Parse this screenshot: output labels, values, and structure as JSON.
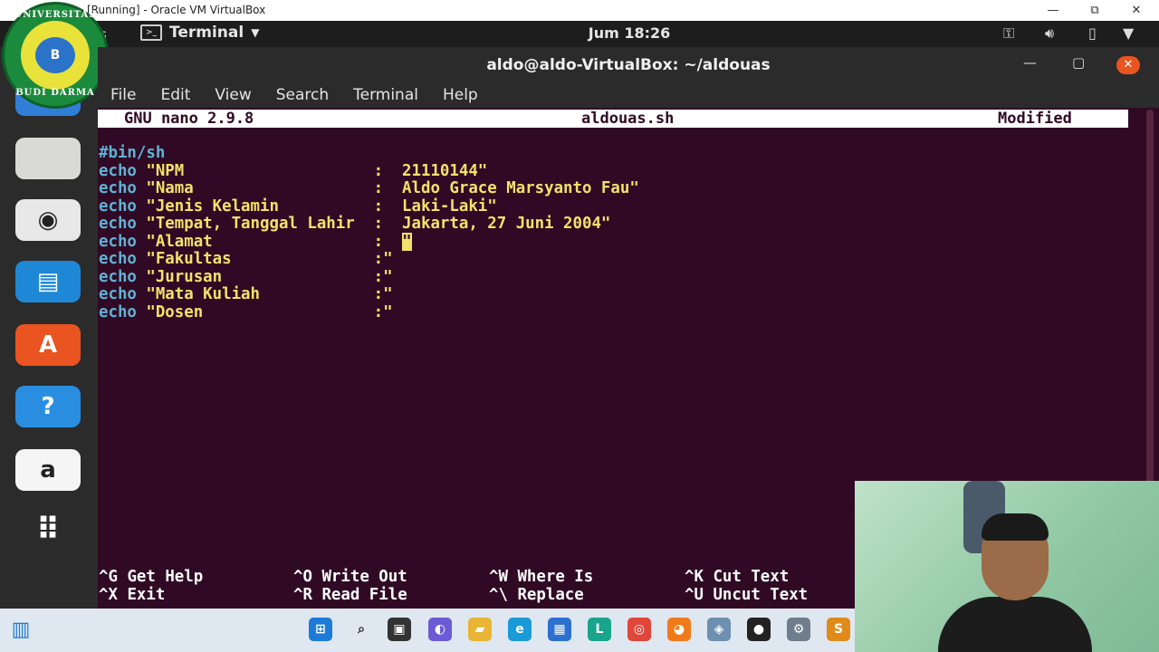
{
  "vbox": {
    "title": "[Running] - Oracle VM VirtualBox",
    "min": "—",
    "max": "⧉",
    "close": "✕"
  },
  "topbar": {
    "activities": "s",
    "app_menu": "Terminal",
    "app_icon_text": ">_",
    "clock": "Jum 18:26"
  },
  "logo": {
    "top_text": "UNIVERSITAS",
    "bottom_text": "BUDI DARMA",
    "center": "B"
  },
  "terminal": {
    "title": "aldo@aldo-VirtualBox: ~/aldouas",
    "menu": [
      "File",
      "Edit",
      "View",
      "Search",
      "Terminal",
      "Help"
    ]
  },
  "nano": {
    "version": "GNU nano 2.9.8",
    "filename": "aldouas.sh",
    "status": "Modified",
    "shebang": "#bin/sh",
    "lines": [
      {
        "kw": "echo",
        "text": " \"NPM                    :  21110144\""
      },
      {
        "kw": "echo",
        "text": " \"Nama                   :  Aldo Grace Marsyanto Fau\""
      },
      {
        "kw": "echo",
        "text": " \"Jenis Kelamin          :  Laki-Laki\""
      },
      {
        "kw": "echo",
        "text": " \"Tempat, Tanggal Lahir  :  Jakarta, 27 Juni 2004\""
      },
      {
        "kw": "echo",
        "text": " \"Alamat                 :  ",
        "cursor": "\""
      },
      {
        "kw": "echo",
        "text": " \"Fakultas               :\""
      },
      {
        "kw": "echo",
        "text": " \"Jurusan                :\""
      },
      {
        "kw": "echo",
        "text": " \"Mata Kuliah            :\""
      },
      {
        "kw": "echo",
        "text": " \"Dosen                  :\""
      }
    ],
    "shortcuts": [
      {
        "key": "^G",
        "label": "Get Help"
      },
      {
        "key": "^O",
        "label": "Write Out"
      },
      {
        "key": "^W",
        "label": "Where Is"
      },
      {
        "key": "^K",
        "label": "Cut Text"
      },
      {
        "key": "^X",
        "label": "Exit"
      },
      {
        "key": "^R",
        "label": "Read File"
      },
      {
        "key": "^\\",
        "label": "Replace"
      },
      {
        "key": "^U",
        "label": "Uncut Text"
      }
    ]
  },
  "dock": [
    {
      "name": "thunderbird-icon",
      "glyph": "✉",
      "color": "#2f7fd8"
    },
    {
      "name": "files-icon",
      "glyph": "",
      "color": "#d9d9d6"
    },
    {
      "name": "rhythmbox-icon",
      "glyph": "◉",
      "color": "#e8e8e8"
    },
    {
      "name": "writer-icon",
      "glyph": "▤",
      "color": "#1e88d6"
    },
    {
      "name": "software-icon",
      "glyph": "A",
      "color": "#e95420"
    },
    {
      "name": "help-icon",
      "glyph": "?",
      "color": "#2a8ee0"
    },
    {
      "name": "amazon-icon",
      "glyph": "a",
      "color": "#f5f5f5"
    },
    {
      "name": "app-grid-icon",
      "glyph": "⠿",
      "color": "transparent"
    }
  ],
  "taskbar": [
    {
      "name": "windows-start-icon",
      "glyph": "⊞",
      "color": "#1c7bd8"
    },
    {
      "name": "search-icon",
      "glyph": "⌕",
      "color": "transparent"
    },
    {
      "name": "task-view-icon",
      "glyph": "▣",
      "color": "#333333"
    },
    {
      "name": "chat-icon",
      "glyph": "◐",
      "color": "#6b5bd6"
    },
    {
      "name": "file-explorer-icon",
      "glyph": "▰",
      "color": "#e8b535"
    },
    {
      "name": "edge-icon",
      "glyph": "e",
      "color": "#1a9ad6"
    },
    {
      "name": "store-icon",
      "glyph": "▦",
      "color": "#2b6fd0"
    },
    {
      "name": "l-app-icon",
      "glyph": "L",
      "color": "#18a58c"
    },
    {
      "name": "chrome-icon",
      "glyph": "◎",
      "color": "#e0463a"
    },
    {
      "name": "firefox-icon",
      "glyph": "◕",
      "color": "#f07a1a"
    },
    {
      "name": "virtualbox-icon",
      "glyph": "◈",
      "color": "#6d8fb0"
    },
    {
      "name": "obs-icon",
      "glyph": "●",
      "color": "#222222"
    },
    {
      "name": "settings-icon",
      "glyph": "⚙",
      "color": "#6f7d8c"
    },
    {
      "name": "sublime-icon",
      "glyph": "S",
      "color": "#e08a1a"
    }
  ],
  "snap_icon": "▥"
}
